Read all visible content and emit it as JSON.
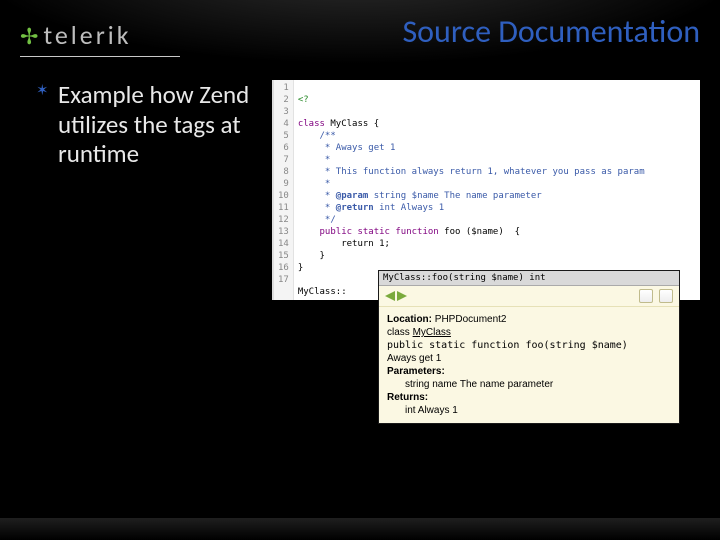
{
  "header": {
    "brand_symbol": "✢",
    "brand": "telerik",
    "title": "Source Documentation"
  },
  "bullet": {
    "text": "Example how Zend utilizes the tags at runtime"
  },
  "code": {
    "gutter": [
      "1",
      "2",
      "3",
      "4",
      "5",
      "6",
      "7",
      "8",
      "9",
      "10",
      "11",
      "12",
      "13",
      "14",
      "15",
      "16",
      "17"
    ],
    "l1": "<?",
    "l3_a": "class ",
    "l3_b": "MyClass ",
    "l3_c": "{",
    "l4": "    /**",
    "l5": "     * Aways get 1",
    "l6": "     *",
    "l7": "     * This function always return 1, whatever you pass as param",
    "l8": "     *",
    "l9_a": "     * ",
    "l9_b": "@param",
    "l9_c": " string $name The name parameter",
    "l10_a": "     * ",
    "l10_b": "@return",
    "l10_c": " int Always 1",
    "l11": "     */",
    "l12_a": "    public static function ",
    "l12_b": "foo ",
    "l12_c": "($name)  {",
    "l13": "        return 1;",
    "l14": "    }",
    "l15": "}",
    "l16": "",
    "l17": "MyClass::"
  },
  "tooltip": {
    "signature": "MyClass::foo(string $name)  int",
    "loc_label": "Location:",
    "loc_value": "PHPDocument2",
    "class_label": "class",
    "class_value": "MyClass",
    "sig_full": "public static function foo(string $name)",
    "summary": "Aways get 1",
    "params_label": "Parameters:",
    "param_row": "string name The name parameter",
    "returns_label": "Returns:",
    "return_row": "int Always 1"
  }
}
